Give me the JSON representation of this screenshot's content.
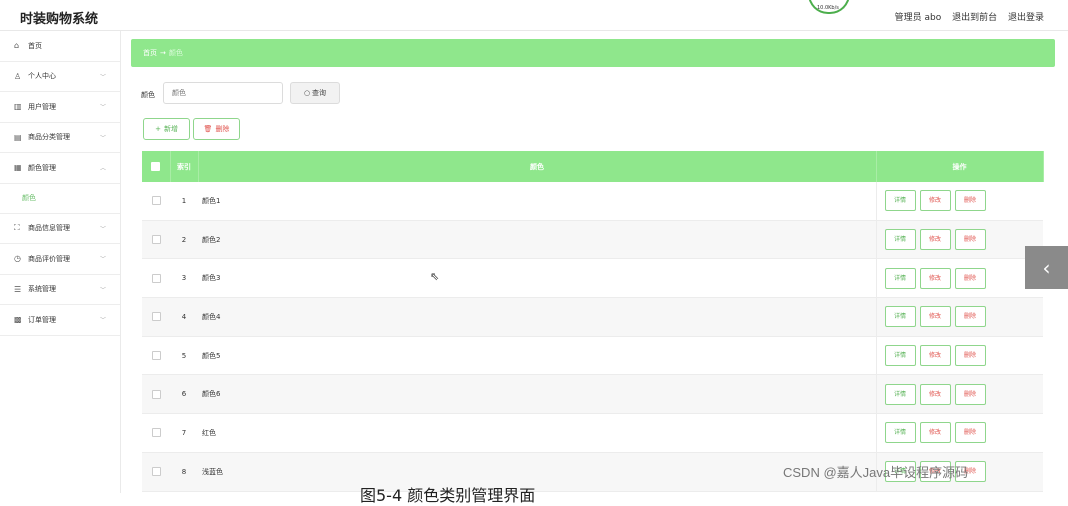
{
  "header": {
    "title": "时装购物系统",
    "speed": "10.0Kb/s",
    "admin": "管理员 abo",
    "back_front": "退出到前台",
    "logout": "退出登录"
  },
  "sidebar": {
    "items": [
      {
        "label": "首页",
        "icon": "home-icon",
        "glyph": "⌂"
      },
      {
        "label": "个人中心",
        "icon": "user-icon",
        "glyph": "👤"
      },
      {
        "label": "用户管理",
        "icon": "users-icon",
        "glyph": "▥"
      },
      {
        "label": "商品分类管理",
        "icon": "category-icon",
        "glyph": "▤"
      },
      {
        "label": "颜色管理",
        "icon": "color-icon",
        "glyph": "▦"
      },
      {
        "label": "商品信息管理",
        "icon": "goods-icon",
        "glyph": "⛶"
      },
      {
        "label": "商品评价管理",
        "icon": "review-icon",
        "glyph": "◷"
      },
      {
        "label": "系统管理",
        "icon": "system-icon",
        "glyph": "☰"
      },
      {
        "label": "订单管理",
        "icon": "order-icon",
        "glyph": "▩"
      }
    ],
    "sub_item": "颜色"
  },
  "breadcrumb": {
    "home": "首页",
    "arrow": "→",
    "current": "颜色"
  },
  "search": {
    "label": "颜色",
    "placeholder": "颜色",
    "button": "查询"
  },
  "actions": {
    "add": "新增",
    "delete": "删除"
  },
  "table": {
    "headers": {
      "index": "索引",
      "color": "颜色",
      "ops": "操作"
    },
    "op_labels": {
      "detail": "详情",
      "edit": "修改",
      "remove": "删除"
    },
    "rows": [
      {
        "idx": "1",
        "name": "颜色1"
      },
      {
        "idx": "2",
        "name": "颜色2"
      },
      {
        "idx": "3",
        "name": "颜色3"
      },
      {
        "idx": "4",
        "name": "颜色4"
      },
      {
        "idx": "5",
        "name": "颜色5"
      },
      {
        "idx": "6",
        "name": "颜色6"
      },
      {
        "idx": "7",
        "name": "红色"
      },
      {
        "idx": "8",
        "name": "浅蓝色"
      }
    ]
  },
  "colors": {
    "accent": "#8fe78c",
    "danger": "#e0534d",
    "success": "#59b357"
  },
  "watermark": "CSDN @嘉人Java毕设程序源码",
  "caption": "图5-4 颜色类别管理界面"
}
